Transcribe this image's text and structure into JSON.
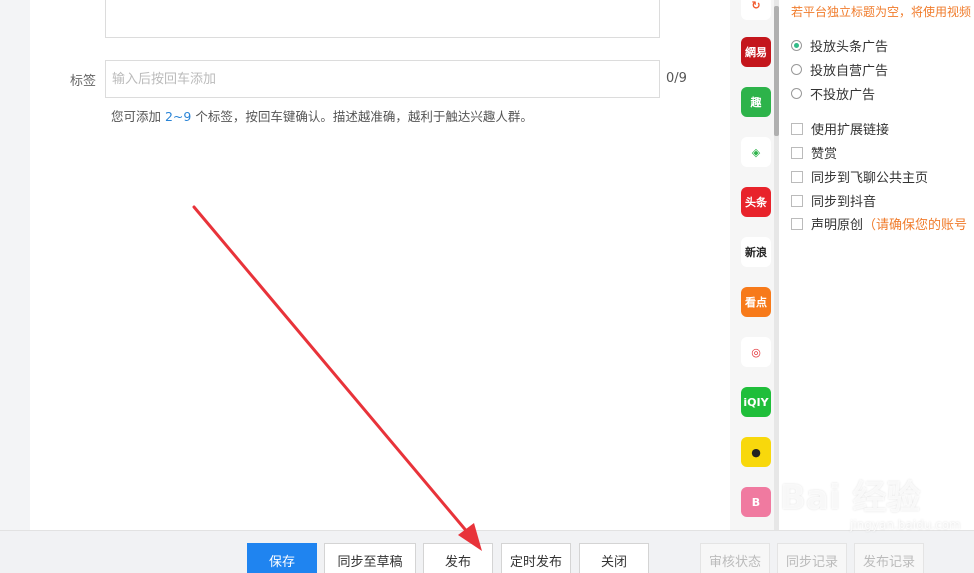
{
  "tags": {
    "label": "标签",
    "placeholder": "输入后按回车添加",
    "count": "0/9",
    "hint_prefix": "您可添加 ",
    "hint_range": "2~9",
    "hint_suffix": " 个标签，按回车键确认。描述越准确，越利于触达兴趣人群。"
  },
  "platforms": [
    {
      "name": "platform-icon-top",
      "text": "↻",
      "color": "#ffffff",
      "fg": "#f0572a"
    },
    {
      "name": "netease-news-icon",
      "text": "網易",
      "color": "#c4161c",
      "fg": "#ffffff"
    },
    {
      "name": "qutoutiao-icon",
      "text": "趣",
      "color": "#2db34a",
      "fg": "#ffffff"
    },
    {
      "name": "iqiyi-eye-icon",
      "text": "◈",
      "color": "#ffffff",
      "fg": "#2db34a"
    },
    {
      "name": "toutiao-icon",
      "text": "头条",
      "color": "#e8232b",
      "fg": "#ffffff"
    },
    {
      "name": "sina-icon",
      "text": "新浪",
      "color": "#ffffff",
      "fg": "#222222"
    },
    {
      "name": "video-platform-icon",
      "text": "看点",
      "color": "#f77a1a",
      "fg": "#ffffff"
    },
    {
      "name": "phoenix-icon",
      "text": "◎",
      "color": "#ffffff",
      "fg": "#e1252b"
    },
    {
      "name": "iqiyi-icon",
      "text": "iQIY",
      "color": "#1fbe3a",
      "fg": "#ffffff"
    },
    {
      "name": "camera-app-icon",
      "text": "●",
      "color": "#f8d80c",
      "fg": "#222222"
    },
    {
      "name": "pink-app-icon",
      "text": "B",
      "color": "#f07aa0",
      "fg": "#ffffff"
    }
  ],
  "settings": {
    "note": "若平台独立标题为空，将使用视频",
    "ad_options": [
      "投放头条广告",
      "投放自营广告",
      "不投放广告"
    ],
    "ad_selected": 0,
    "checks": [
      "使用扩展链接",
      "赞赏",
      "同步到飞聊公共主页",
      "同步到抖音"
    ],
    "original_label": "声明原创",
    "original_warn": "（请确保您的账号"
  },
  "buttons": {
    "save": "保存",
    "sync_draft": "同步至草稿",
    "publish": "发布",
    "schedule": "定时发布",
    "close": "关闭",
    "review_status": "审核状态",
    "sync_records": "同步记录",
    "publish_records": "发布记录"
  },
  "colors": {
    "primary": "#1f84f0",
    "warning": "#f07c2c",
    "arrow": "#e8333a",
    "link": "#2a84d6"
  },
  "watermark": {
    "brand": "Bai 经验",
    "url": "jingyan.baidu.com"
  }
}
